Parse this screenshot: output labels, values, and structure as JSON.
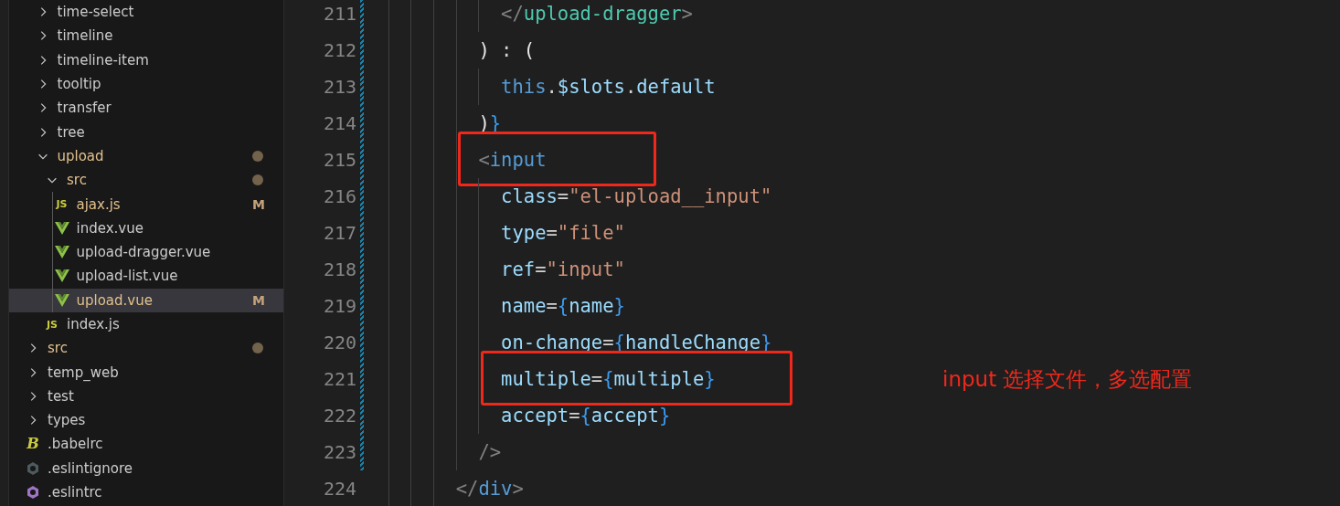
{
  "explorer": {
    "tree": [
      {
        "kind": "offscreen-parent",
        "children": [
          {
            "kind": "folder",
            "label": "time-select",
            "expanded": false,
            "selected": false,
            "modified": false
          },
          {
            "kind": "folder",
            "label": "timeline",
            "expanded": false,
            "selected": false,
            "modified": false
          },
          {
            "kind": "folder",
            "label": "timeline-item",
            "expanded": false,
            "selected": false,
            "modified": false
          },
          {
            "kind": "folder",
            "label": "tooltip",
            "expanded": false,
            "selected": false,
            "modified": false
          },
          {
            "kind": "folder",
            "label": "transfer",
            "expanded": false,
            "selected": false,
            "modified": false
          },
          {
            "kind": "folder",
            "label": "tree",
            "expanded": false,
            "selected": false,
            "modified": false
          },
          {
            "kind": "folder",
            "label": "upload",
            "expanded": true,
            "selected": false,
            "modified": true,
            "children": [
              {
                "kind": "folder",
                "label": "src",
                "expanded": true,
                "selected": false,
                "modified": true,
                "children": [
                  {
                    "kind": "js",
                    "icon_text": "JS",
                    "label": "ajax.js",
                    "selected": false,
                    "modified": true,
                    "badge": "M"
                  },
                  {
                    "kind": "vue",
                    "label": "index.vue",
                    "selected": false,
                    "modified": false
                  },
                  {
                    "kind": "vue",
                    "label": "upload-dragger.vue",
                    "selected": false,
                    "modified": false
                  },
                  {
                    "kind": "vue",
                    "label": "upload-list.vue",
                    "selected": false,
                    "modified": false
                  },
                  {
                    "kind": "vue",
                    "label": "upload.vue",
                    "selected": true,
                    "modified": true,
                    "badge": "M"
                  }
                ]
              },
              {
                "kind": "js",
                "icon_text": "JS",
                "label": "index.js",
                "selected": false,
                "modified": false
              }
            ]
          }
        ]
      },
      {
        "kind": "folder",
        "label": "src",
        "expanded": false,
        "selected": false,
        "modified": true
      },
      {
        "kind": "folder",
        "label": "temp_web",
        "expanded": false,
        "selected": false,
        "modified": false
      },
      {
        "kind": "folder",
        "label": "test",
        "expanded": false,
        "selected": false,
        "modified": false
      },
      {
        "kind": "folder",
        "label": "types",
        "expanded": false,
        "selected": false,
        "modified": false
      },
      {
        "kind": "babel",
        "icon_text": "B",
        "label": ".babelrc",
        "selected": false,
        "modified": false
      },
      {
        "kind": "eslintignore",
        "label": ".eslintignore",
        "selected": false,
        "modified": false
      },
      {
        "kind": "eslint",
        "label": ".eslintrc",
        "selected": false,
        "modified": false
      }
    ]
  },
  "editor": {
    "lines": [
      {
        "number": "211",
        "changed": true,
        "boxed": false,
        "tokens": [
          {
            "kind": "punct",
            "text": "            </"
          },
          {
            "kind": "component",
            "text": "upload-dragger"
          },
          {
            "kind": "punct",
            "text": ">"
          }
        ]
      },
      {
        "number": "212",
        "changed": true,
        "boxed": false,
        "tokens": [
          {
            "kind": "paren",
            "text": "          )"
          },
          {
            "kind": "op",
            "text": " : "
          },
          {
            "kind": "paren",
            "text": "("
          }
        ]
      },
      {
        "number": "213",
        "changed": true,
        "boxed": false,
        "tokens": [
          {
            "kind": "keyword",
            "text": "            this"
          },
          {
            "kind": "op",
            "text": "."
          },
          {
            "kind": "variable",
            "text": "$slots"
          },
          {
            "kind": "op",
            "text": "."
          },
          {
            "kind": "variable",
            "text": "default"
          }
        ]
      },
      {
        "number": "214",
        "changed": true,
        "boxed": false,
        "tokens": [
          {
            "kind": "paren",
            "text": "          )"
          },
          {
            "kind": "brace",
            "text": "}"
          }
        ]
      },
      {
        "number": "215",
        "changed": true,
        "boxed": true,
        "tokens": [
          {
            "kind": "punct",
            "text": "          <"
          },
          {
            "kind": "tag",
            "text": "input"
          }
        ]
      },
      {
        "number": "216",
        "changed": true,
        "boxed": false,
        "tokens": [
          {
            "kind": "attr",
            "text": "            class"
          },
          {
            "kind": "op",
            "text": "="
          },
          {
            "kind": "string",
            "text": "\"el-upload__input\""
          }
        ]
      },
      {
        "number": "217",
        "changed": true,
        "boxed": false,
        "tokens": [
          {
            "kind": "attr",
            "text": "            type"
          },
          {
            "kind": "op",
            "text": "="
          },
          {
            "kind": "string",
            "text": "\"file\""
          }
        ]
      },
      {
        "number": "218",
        "changed": true,
        "boxed": false,
        "tokens": [
          {
            "kind": "attr",
            "text": "            ref"
          },
          {
            "kind": "op",
            "text": "="
          },
          {
            "kind": "string",
            "text": "\"input\""
          }
        ]
      },
      {
        "number": "219",
        "changed": true,
        "boxed": false,
        "tokens": [
          {
            "kind": "attr",
            "text": "            name"
          },
          {
            "kind": "op",
            "text": "="
          },
          {
            "kind": "brace",
            "text": "{"
          },
          {
            "kind": "variable",
            "text": "name"
          },
          {
            "kind": "brace",
            "text": "}"
          }
        ]
      },
      {
        "number": "220",
        "changed": true,
        "boxed": false,
        "tokens": [
          {
            "kind": "attr",
            "text": "            on-change"
          },
          {
            "kind": "op",
            "text": "="
          },
          {
            "kind": "brace",
            "text": "{"
          },
          {
            "kind": "variable",
            "text": "handleChange"
          },
          {
            "kind": "brace",
            "text": "}"
          }
        ]
      },
      {
        "number": "221",
        "changed": true,
        "boxed": true,
        "note": "input 选择文件，多选配置",
        "tokens": [
          {
            "kind": "attr",
            "text": "            multiple"
          },
          {
            "kind": "op",
            "text": "="
          },
          {
            "kind": "brace",
            "text": "{"
          },
          {
            "kind": "variable",
            "text": "multiple"
          },
          {
            "kind": "brace",
            "text": "}"
          }
        ]
      },
      {
        "number": "222",
        "changed": true,
        "boxed": false,
        "tokens": [
          {
            "kind": "attr",
            "text": "            accept"
          },
          {
            "kind": "op",
            "text": "="
          },
          {
            "kind": "brace",
            "text": "{"
          },
          {
            "kind": "variable",
            "text": "accept"
          },
          {
            "kind": "brace",
            "text": "}"
          }
        ]
      },
      {
        "number": "223",
        "changed": true,
        "boxed": false,
        "tokens": [
          {
            "kind": "punct",
            "text": "          />"
          }
        ]
      },
      {
        "number": "224",
        "changed": false,
        "boxed": false,
        "tokens": [
          {
            "kind": "punct",
            "text": "        </"
          },
          {
            "kind": "tag",
            "text": "div"
          },
          {
            "kind": "punct",
            "text": ">"
          }
        ]
      }
    ]
  }
}
